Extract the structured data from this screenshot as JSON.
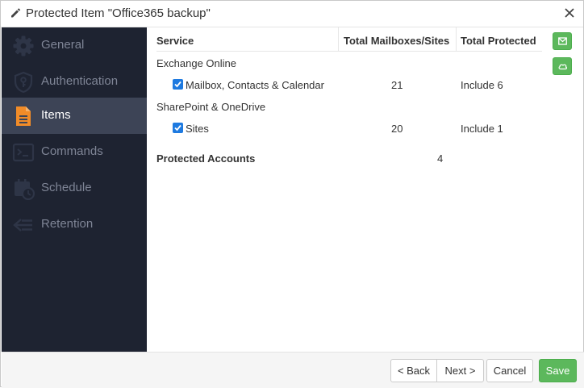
{
  "window": {
    "title": "Protected Item \"Office365 backup\""
  },
  "sidebar": {
    "items": [
      {
        "label": "General",
        "icon": "gear-icon"
      },
      {
        "label": "Authentication",
        "icon": "shield-key-icon"
      },
      {
        "label": "Items",
        "icon": "document-icon",
        "active": true
      },
      {
        "label": "Commands",
        "icon": "terminal-icon"
      },
      {
        "label": "Schedule",
        "icon": "calendar-clock-icon"
      },
      {
        "label": "Retention",
        "icon": "arrow-lines-icon"
      }
    ]
  },
  "table": {
    "headers": [
      "Service",
      "Total Mailboxes/Sites",
      "Total Protected"
    ],
    "groups": [
      {
        "name": "Exchange Online",
        "row": {
          "label": "Mailbox, Contacts & Calendar",
          "checked": true,
          "total": "21",
          "protected": "Include 6"
        }
      },
      {
        "name": "SharePoint & OneDrive",
        "row": {
          "label": "Sites",
          "checked": true,
          "total": "20",
          "protected": "Include 1"
        }
      }
    ],
    "protected_accounts_label": "Protected Accounts",
    "protected_accounts_value": "4"
  },
  "footer": {
    "back": "< Back",
    "next": "Next >",
    "cancel": "Cancel",
    "save": "Save"
  },
  "colors": {
    "sidebar_bg": "#1e2331",
    "active_item_bg": "#3d4456",
    "accent_orange": "#f28c28",
    "save_green": "#5cb85c",
    "checkbox_blue": "#1e7ae0"
  }
}
